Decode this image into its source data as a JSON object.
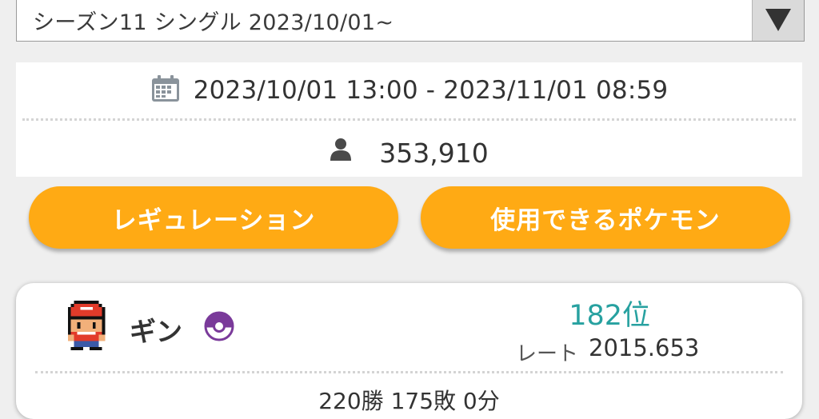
{
  "season_select": {
    "value": "シーズン11 シングル 2023/10/01~",
    "arrow_icon": "triangle-down-icon"
  },
  "season_info": {
    "period": "2023/10/01 13:00 - 2023/11/01 08:59",
    "period_icon": "calendar-icon",
    "player_count": "353,910",
    "player_icon": "person-icon"
  },
  "buttons": {
    "regulation": "レギュレーション",
    "usable_pokemon": "使用できるポケモン"
  },
  "player": {
    "name": "ギン",
    "ball_icon": "master-ball-icon",
    "rank": "182位",
    "rate_label": "レート",
    "rate_value": "2015.653",
    "record": "220勝 175敗 0分"
  },
  "colors": {
    "accent_orange": "#ffaa14",
    "rank_teal": "#27a1a0",
    "ball_purple": "#7a3a9a",
    "background": "#efefef"
  }
}
